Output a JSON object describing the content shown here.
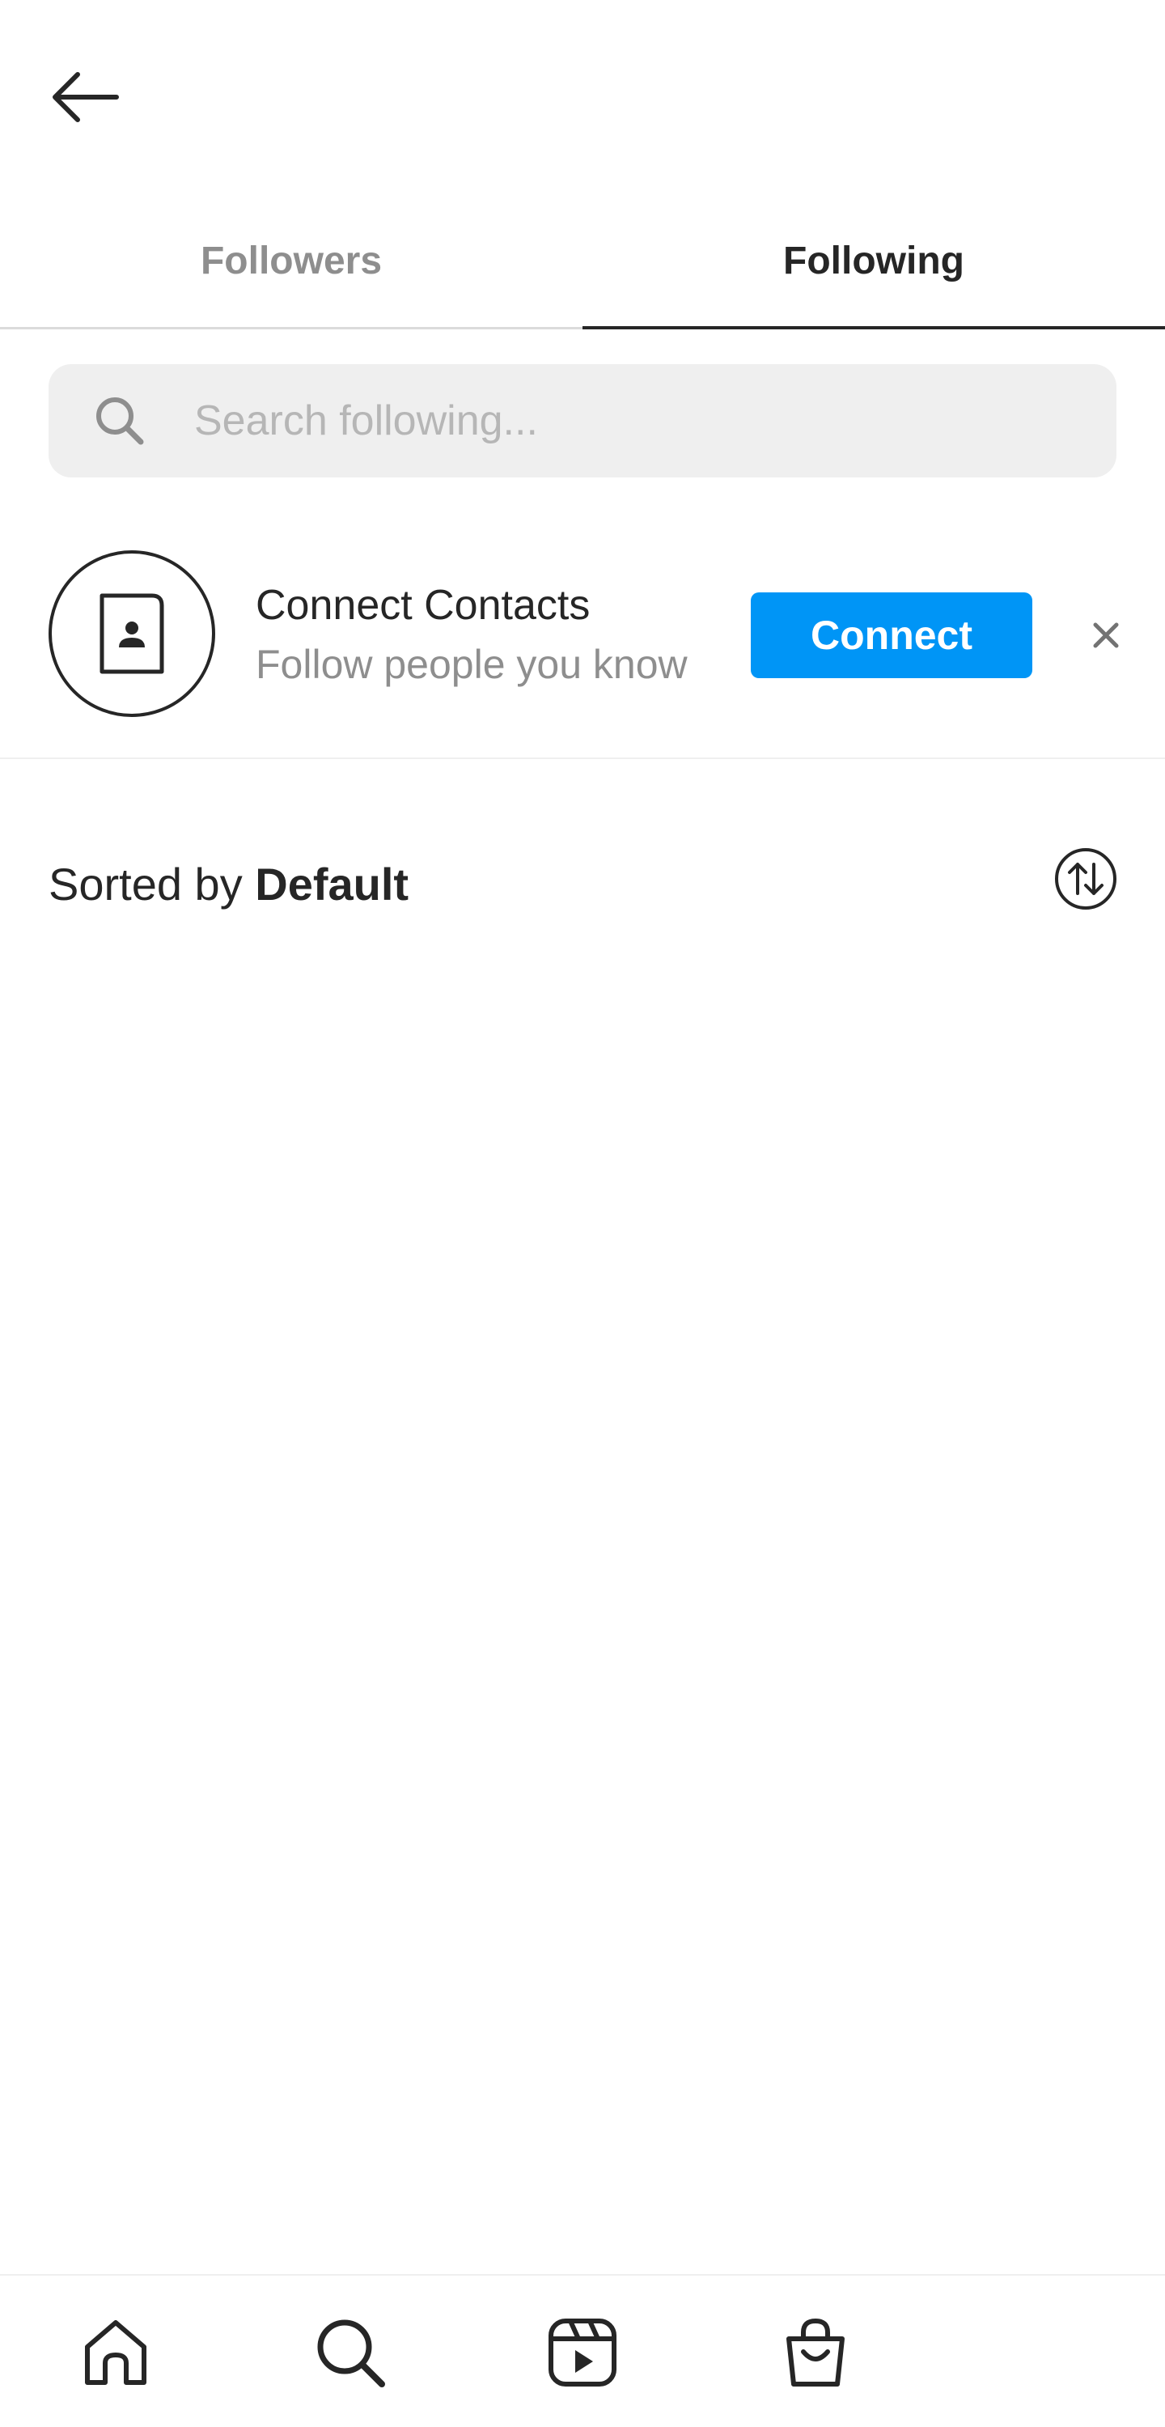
{
  "header": {
    "back_icon": "arrow-left-icon"
  },
  "tabs": [
    {
      "label": "Followers",
      "active": false
    },
    {
      "label": "Following",
      "active": true
    }
  ],
  "search": {
    "placeholder": "Search following...",
    "value": "",
    "icon": "search-icon"
  },
  "connect_contacts": {
    "title": "Connect Contacts",
    "subtitle": "Follow people you know",
    "button_label": "Connect",
    "button_color": "#0095f6",
    "avatar_icon": "contact-card-icon",
    "dismiss_icon": "close-icon"
  },
  "sort": {
    "prefix": "Sorted by ",
    "value": "Default",
    "icon": "sort-arrows-icon"
  },
  "bottom_nav": [
    {
      "name": "home",
      "icon": "home-icon"
    },
    {
      "name": "search",
      "icon": "search-icon"
    },
    {
      "name": "reels",
      "icon": "reels-icon"
    },
    {
      "name": "shop",
      "icon": "shop-bag-icon"
    }
  ],
  "colors": {
    "text_primary": "#262626",
    "text_secondary": "#8e8e8e",
    "accent": "#0095f6",
    "search_bg": "#efefef"
  }
}
